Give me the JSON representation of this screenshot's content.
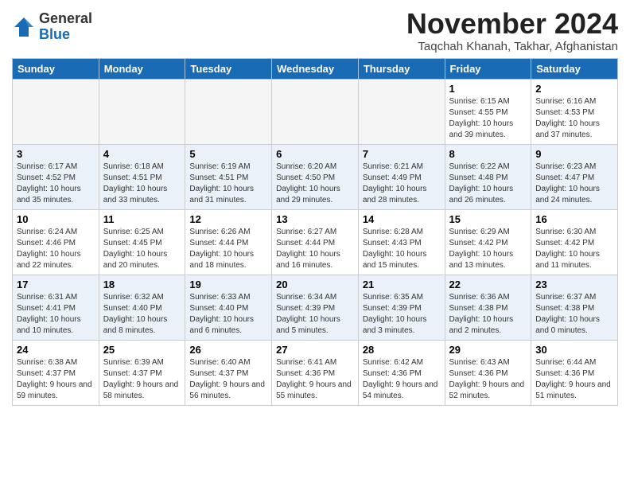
{
  "header": {
    "logo_general": "General",
    "logo_blue": "Blue",
    "month_title": "November 2024",
    "location": "Taqchah Khanah, Takhar, Afghanistan"
  },
  "columns": [
    "Sunday",
    "Monday",
    "Tuesday",
    "Wednesday",
    "Thursday",
    "Friday",
    "Saturday"
  ],
  "weeks": [
    [
      {
        "day": "",
        "info": ""
      },
      {
        "day": "",
        "info": ""
      },
      {
        "day": "",
        "info": ""
      },
      {
        "day": "",
        "info": ""
      },
      {
        "day": "",
        "info": ""
      },
      {
        "day": "1",
        "info": "Sunrise: 6:15 AM\nSunset: 4:55 PM\nDaylight: 10 hours\nand 39 minutes."
      },
      {
        "day": "2",
        "info": "Sunrise: 6:16 AM\nSunset: 4:53 PM\nDaylight: 10 hours\nand 37 minutes."
      }
    ],
    [
      {
        "day": "3",
        "info": "Sunrise: 6:17 AM\nSunset: 4:52 PM\nDaylight: 10 hours\nand 35 minutes."
      },
      {
        "day": "4",
        "info": "Sunrise: 6:18 AM\nSunset: 4:51 PM\nDaylight: 10 hours\nand 33 minutes."
      },
      {
        "day": "5",
        "info": "Sunrise: 6:19 AM\nSunset: 4:51 PM\nDaylight: 10 hours\nand 31 minutes."
      },
      {
        "day": "6",
        "info": "Sunrise: 6:20 AM\nSunset: 4:50 PM\nDaylight: 10 hours\nand 29 minutes."
      },
      {
        "day": "7",
        "info": "Sunrise: 6:21 AM\nSunset: 4:49 PM\nDaylight: 10 hours\nand 28 minutes."
      },
      {
        "day": "8",
        "info": "Sunrise: 6:22 AM\nSunset: 4:48 PM\nDaylight: 10 hours\nand 26 minutes."
      },
      {
        "day": "9",
        "info": "Sunrise: 6:23 AM\nSunset: 4:47 PM\nDaylight: 10 hours\nand 24 minutes."
      }
    ],
    [
      {
        "day": "10",
        "info": "Sunrise: 6:24 AM\nSunset: 4:46 PM\nDaylight: 10 hours\nand 22 minutes."
      },
      {
        "day": "11",
        "info": "Sunrise: 6:25 AM\nSunset: 4:45 PM\nDaylight: 10 hours\nand 20 minutes."
      },
      {
        "day": "12",
        "info": "Sunrise: 6:26 AM\nSunset: 4:44 PM\nDaylight: 10 hours\nand 18 minutes."
      },
      {
        "day": "13",
        "info": "Sunrise: 6:27 AM\nSunset: 4:44 PM\nDaylight: 10 hours\nand 16 minutes."
      },
      {
        "day": "14",
        "info": "Sunrise: 6:28 AM\nSunset: 4:43 PM\nDaylight: 10 hours\nand 15 minutes."
      },
      {
        "day": "15",
        "info": "Sunrise: 6:29 AM\nSunset: 4:42 PM\nDaylight: 10 hours\nand 13 minutes."
      },
      {
        "day": "16",
        "info": "Sunrise: 6:30 AM\nSunset: 4:42 PM\nDaylight: 10 hours\nand 11 minutes."
      }
    ],
    [
      {
        "day": "17",
        "info": "Sunrise: 6:31 AM\nSunset: 4:41 PM\nDaylight: 10 hours\nand 10 minutes."
      },
      {
        "day": "18",
        "info": "Sunrise: 6:32 AM\nSunset: 4:40 PM\nDaylight: 10 hours\nand 8 minutes."
      },
      {
        "day": "19",
        "info": "Sunrise: 6:33 AM\nSunset: 4:40 PM\nDaylight: 10 hours\nand 6 minutes."
      },
      {
        "day": "20",
        "info": "Sunrise: 6:34 AM\nSunset: 4:39 PM\nDaylight: 10 hours\nand 5 minutes."
      },
      {
        "day": "21",
        "info": "Sunrise: 6:35 AM\nSunset: 4:39 PM\nDaylight: 10 hours\nand 3 minutes."
      },
      {
        "day": "22",
        "info": "Sunrise: 6:36 AM\nSunset: 4:38 PM\nDaylight: 10 hours\nand 2 minutes."
      },
      {
        "day": "23",
        "info": "Sunrise: 6:37 AM\nSunset: 4:38 PM\nDaylight: 10 hours\nand 0 minutes."
      }
    ],
    [
      {
        "day": "24",
        "info": "Sunrise: 6:38 AM\nSunset: 4:37 PM\nDaylight: 9 hours\nand 59 minutes."
      },
      {
        "day": "25",
        "info": "Sunrise: 6:39 AM\nSunset: 4:37 PM\nDaylight: 9 hours\nand 58 minutes."
      },
      {
        "day": "26",
        "info": "Sunrise: 6:40 AM\nSunset: 4:37 PM\nDaylight: 9 hours\nand 56 minutes."
      },
      {
        "day": "27",
        "info": "Sunrise: 6:41 AM\nSunset: 4:36 PM\nDaylight: 9 hours\nand 55 minutes."
      },
      {
        "day": "28",
        "info": "Sunrise: 6:42 AM\nSunset: 4:36 PM\nDaylight: 9 hours\nand 54 minutes."
      },
      {
        "day": "29",
        "info": "Sunrise: 6:43 AM\nSunset: 4:36 PM\nDaylight: 9 hours\nand 52 minutes."
      },
      {
        "day": "30",
        "info": "Sunrise: 6:44 AM\nSunset: 4:36 PM\nDaylight: 9 hours\nand 51 minutes."
      }
    ]
  ]
}
